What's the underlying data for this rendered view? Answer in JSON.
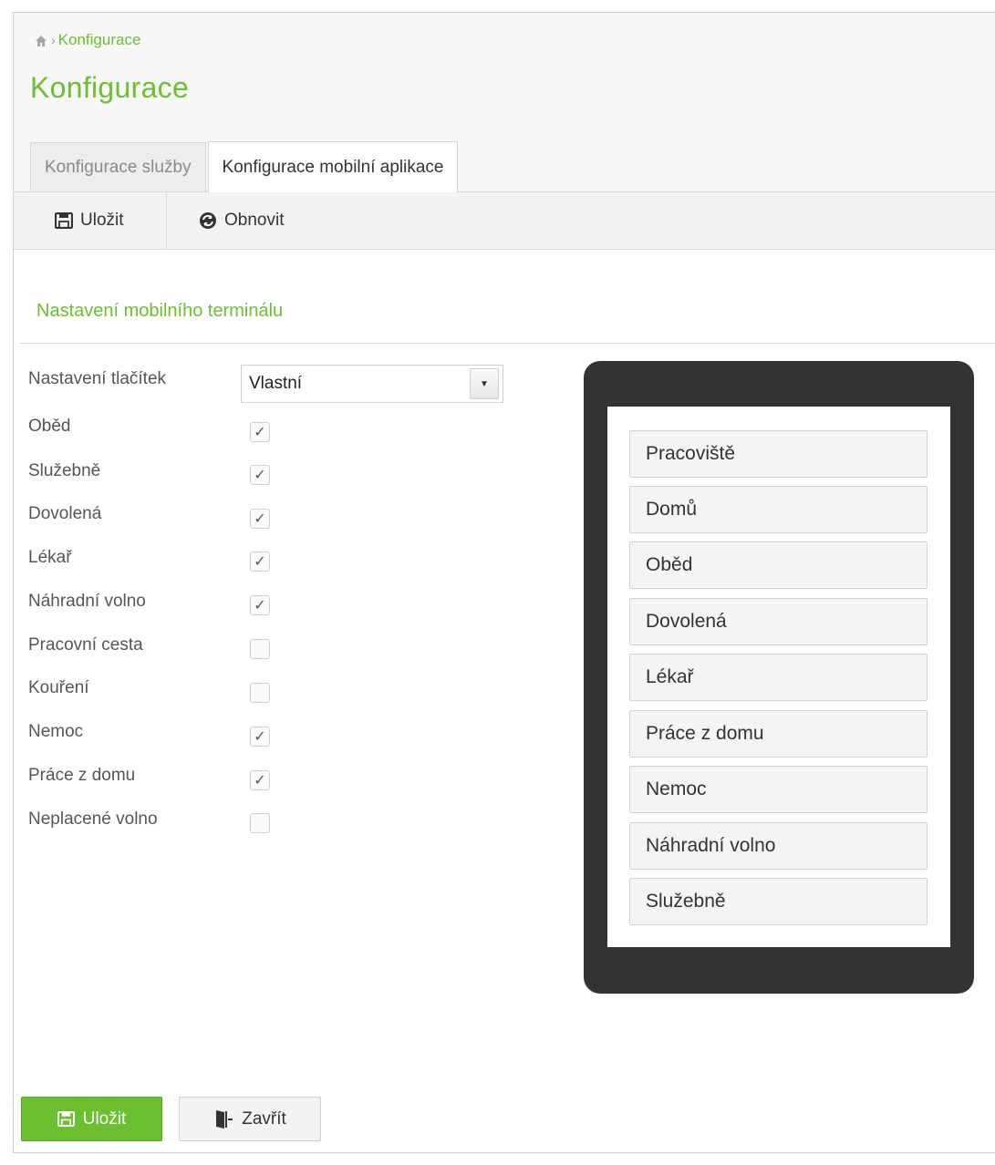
{
  "breadcrumb": {
    "home_icon": "home-icon",
    "current": "Konfigurace"
  },
  "page": {
    "title": "Konfigurace"
  },
  "tabs": [
    {
      "label": "Konfigurace služby",
      "active": false
    },
    {
      "label": "Konfigurace mobilní aplikace",
      "active": true
    }
  ],
  "toolbar": {
    "save": {
      "label": "Uložit",
      "icon": "save-icon"
    },
    "refresh": {
      "label": "Obnovit",
      "icon": "refresh-icon"
    }
  },
  "section": {
    "title": "Nastavení mobilního terminálu"
  },
  "form": {
    "button_setting_label": "Nastavení tlačítek",
    "button_setting_value": "Vlastní",
    "options": [
      {
        "label": "Oběd",
        "checked": true
      },
      {
        "label": "Služebně",
        "checked": true
      },
      {
        "label": "Dovolená",
        "checked": true
      },
      {
        "label": "Lékař",
        "checked": true
      },
      {
        "label": "Náhradní volno",
        "checked": true
      },
      {
        "label": "Pracovní cesta",
        "checked": false
      },
      {
        "label": "Kouření",
        "checked": false
      },
      {
        "label": "Nemoc",
        "checked": true
      },
      {
        "label": "Práce z domu",
        "checked": true
      },
      {
        "label": "Neplacené volno",
        "checked": false
      }
    ]
  },
  "preview": {
    "buttons": [
      "Pracoviště",
      "Domů",
      "Oběd",
      "Dovolená",
      "Lékař",
      "Práce z domu",
      "Nemoc",
      "Náhradní volno",
      "Služebně"
    ]
  },
  "footer": {
    "save_label": "Uložit",
    "close_label": "Zavřít"
  },
  "colors": {
    "accent": "#6cbf2f",
    "device": "#333333"
  }
}
